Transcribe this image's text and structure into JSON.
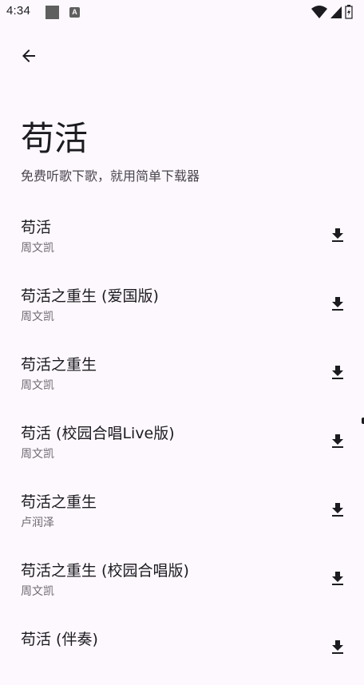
{
  "status_bar": {
    "time": "4:34",
    "notification_icons": [
      "gallery-icon",
      "text-a-icon"
    ],
    "right_icons": [
      "wifi-icon",
      "cell-signal-icon",
      "battery-icon"
    ]
  },
  "header": {
    "back_icon": "arrow-left-icon",
    "title": "苟活",
    "subtitle": "免费听歌下歌，就用简单下载器"
  },
  "songs": [
    {
      "title": "苟活",
      "artist": "周文凯"
    },
    {
      "title": "苟活之重生 (爱国版)",
      "artist": "周文凯"
    },
    {
      "title": "苟活之重生",
      "artist": "周文凯"
    },
    {
      "title": "苟活 (校园合唱Live版)",
      "artist": "周文凯"
    },
    {
      "title": "苟活之重生",
      "artist": "卢润泽"
    },
    {
      "title": "苟活之重生 (校园合唱版)",
      "artist": "周文凯"
    },
    {
      "title": "苟活 (伴奏)",
      "artist": ""
    }
  ],
  "colors": {
    "background": "#fdf8fd",
    "text_primary": "#1c1b1f",
    "text_secondary": "#6f6a73"
  }
}
